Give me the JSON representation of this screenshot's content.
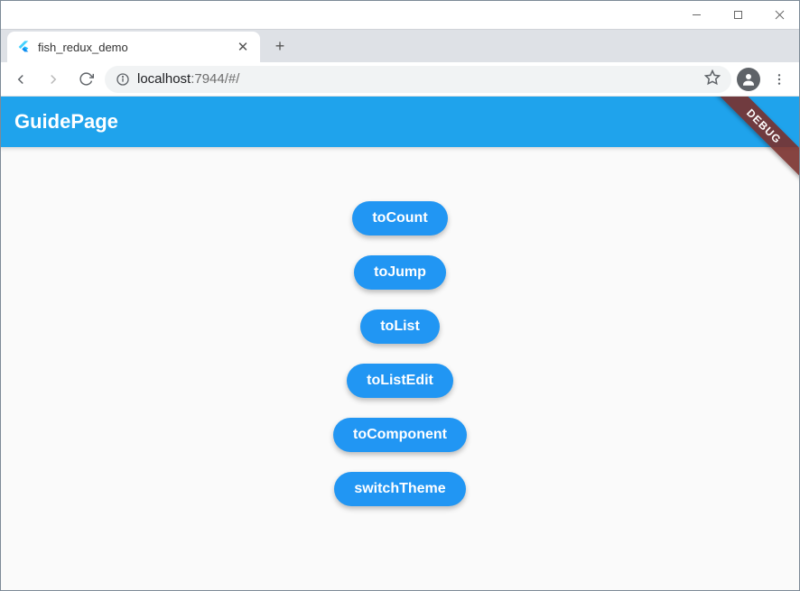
{
  "window": {
    "tab_title": "fish_redux_demo",
    "url_host": "localhost",
    "url_port_path": ":7944/#/"
  },
  "app": {
    "appbar_title": "GuidePage",
    "debug_label": "DEBUG",
    "buttons": [
      {
        "label": "toCount"
      },
      {
        "label": "toJump"
      },
      {
        "label": "toList"
      },
      {
        "label": "toListEdit"
      },
      {
        "label": "toComponent"
      },
      {
        "label": "switchTheme"
      }
    ]
  },
  "colors": {
    "primary": "#2196f3",
    "appbar": "#1fa3ec"
  }
}
